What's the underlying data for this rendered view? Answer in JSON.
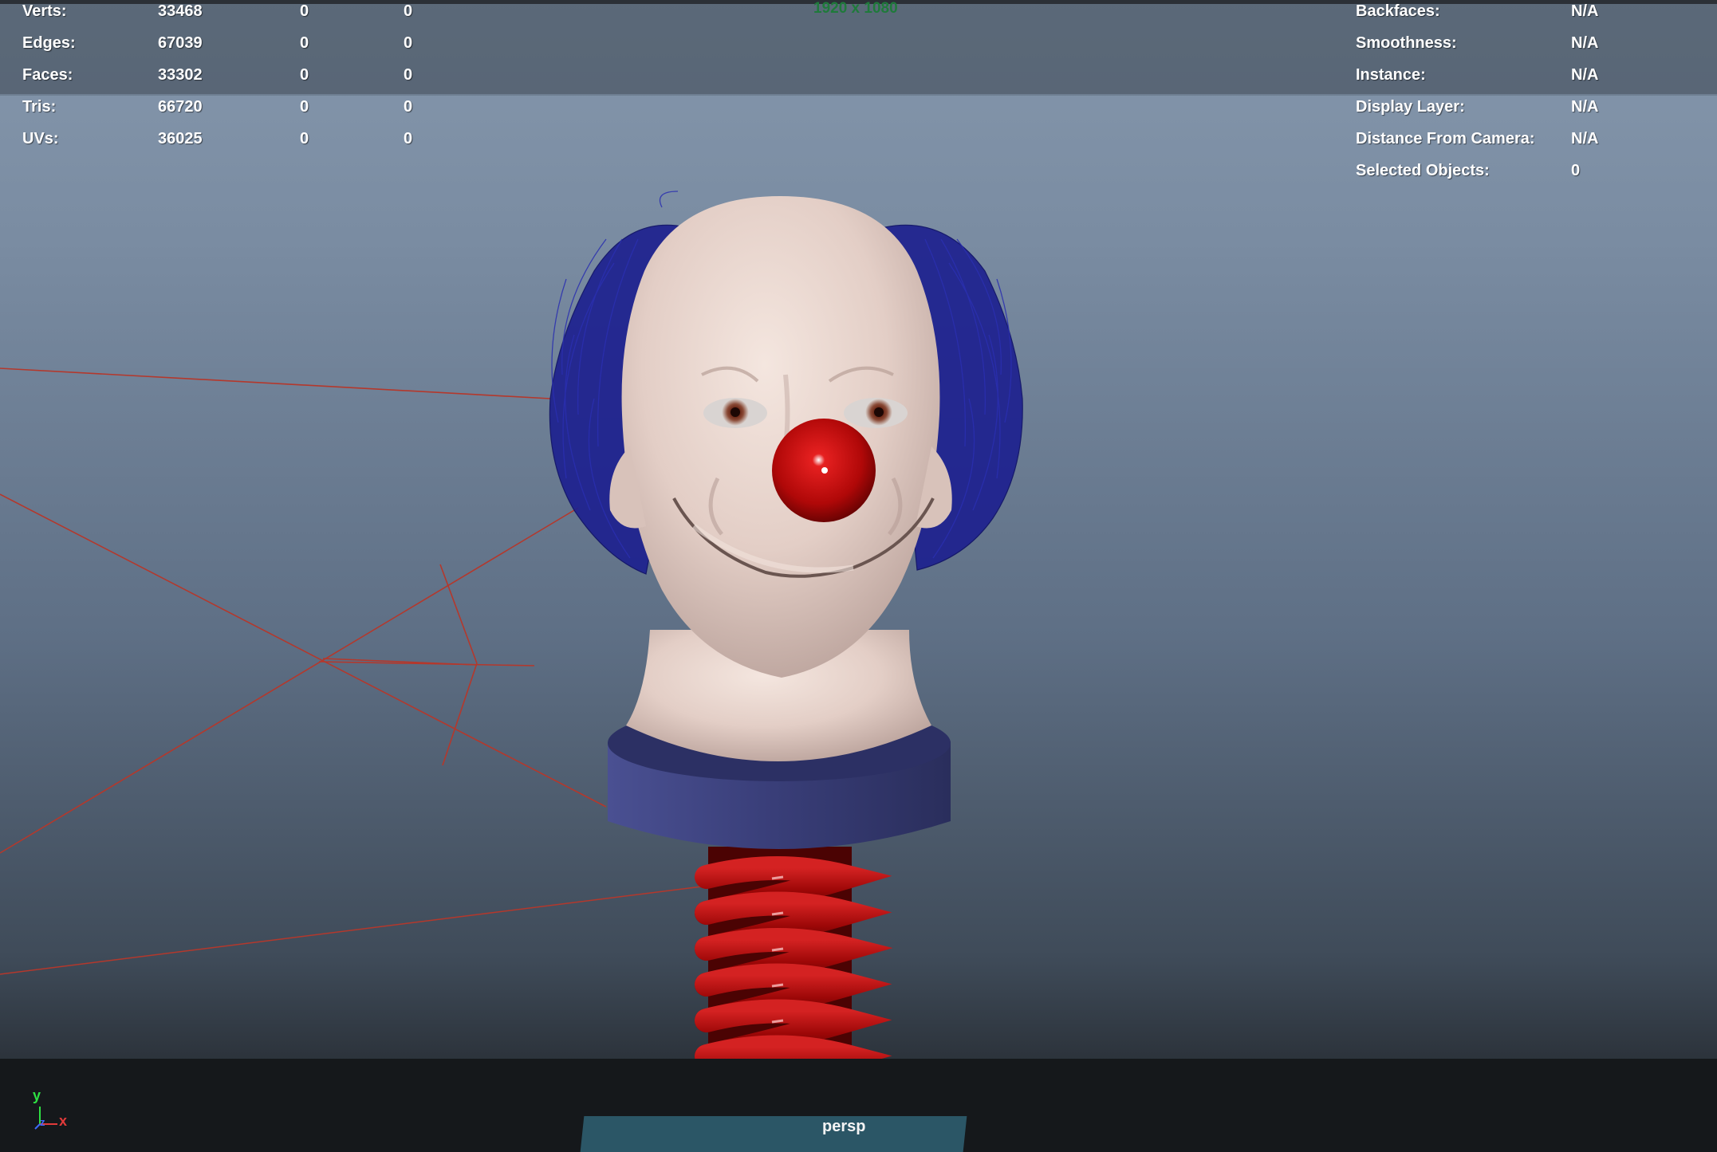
{
  "viewport": {
    "resolution_gate": "1920 x 1080",
    "camera_label": "persp",
    "axes": {
      "y": "y",
      "x": "x",
      "z": "z"
    }
  },
  "heads_up": {
    "poly_count": [
      {
        "label": "Verts:",
        "value": "33468",
        "selected": "0",
        "uv": "0"
      },
      {
        "label": "Edges:",
        "value": "67039",
        "selected": "0",
        "uv": "0"
      },
      {
        "label": "Faces:",
        "value": "33302",
        "selected": "0",
        "uv": "0"
      },
      {
        "label": "Tris:",
        "value": "66720",
        "selected": "0",
        "uv": "0"
      },
      {
        "label": "UVs:",
        "value": "36025",
        "selected": "0",
        "uv": "0"
      }
    ],
    "object_details": [
      {
        "label": "Backfaces:",
        "value": "N/A"
      },
      {
        "label": "Smoothness:",
        "value": "N/A"
      },
      {
        "label": "Instance:",
        "value": "N/A"
      },
      {
        "label": "Display Layer:",
        "value": "N/A"
      },
      {
        "label": "Distance From Camera:",
        "value": "N/A"
      },
      {
        "label": "Selected Objects:",
        "value": "0"
      }
    ]
  },
  "colors": {
    "hair": "#1c1f8f",
    "skin": "#e6d2cb",
    "nose": "#c50d0d",
    "collar": "#3b4076",
    "spring": "#a30909",
    "camera_lines": "#b4382c"
  }
}
